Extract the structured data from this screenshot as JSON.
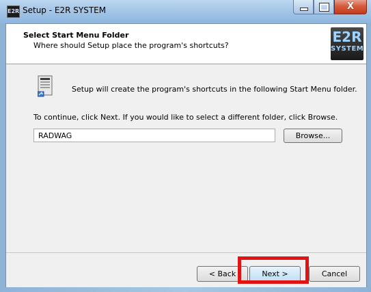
{
  "window": {
    "title": "Setup - E2R SYSTEM",
    "title_icon_text": "E2R",
    "controls": {
      "minimize": "minimize",
      "maximize": "maximize",
      "close": "X"
    }
  },
  "header": {
    "title": "Select Start Menu Folder",
    "subtitle": "Where should Setup place the program's shortcuts?",
    "logo_line1": "E2R",
    "logo_line2": "SYSTEM"
  },
  "body": {
    "info_text": "Setup will create the program's shortcuts in the following Start Menu folder.",
    "continue_text": "To continue, click Next. If you would like to select a different folder, click Browse.",
    "folder_value": "RADWAG",
    "browse_label": "Browse..."
  },
  "footer": {
    "back_label": "< Back",
    "next_label": "Next >",
    "cancel_label": "Cancel"
  },
  "colors": {
    "highlight": "#e01414",
    "titlebar": "#a7c8e8"
  },
  "icons": [
    "folder-shortcut-icon",
    "e2r-logo",
    "close-icon",
    "minimize-icon",
    "maximize-icon"
  ]
}
